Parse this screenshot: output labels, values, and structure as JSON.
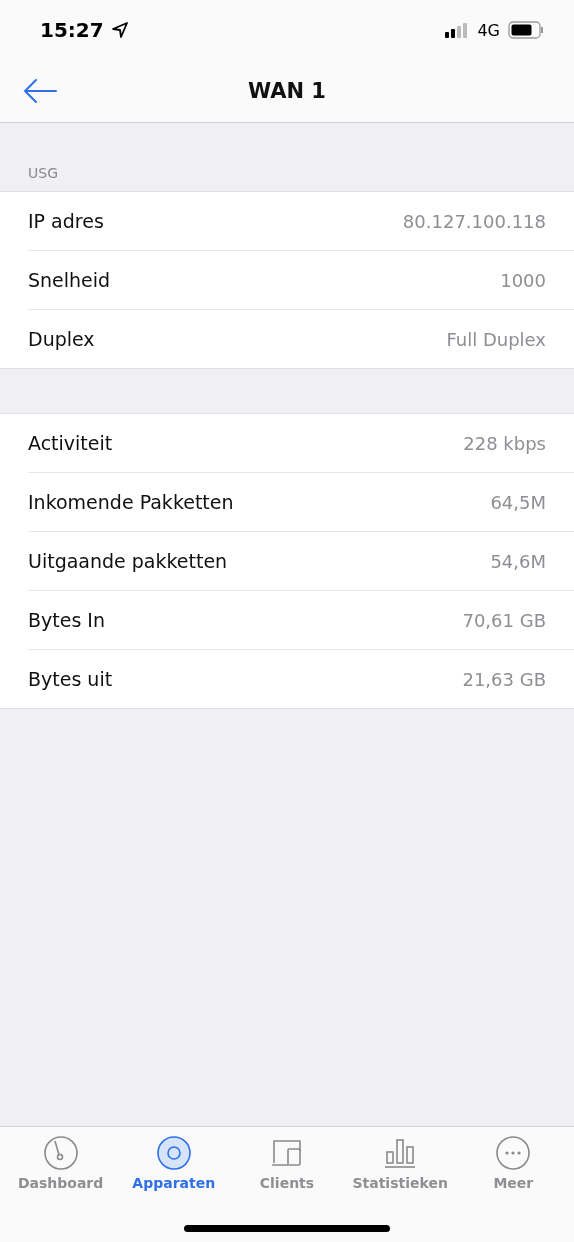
{
  "status_bar": {
    "time": "15:27",
    "network": "4G"
  },
  "nav": {
    "title": "WAN 1"
  },
  "sections": [
    {
      "header": "USG",
      "rows": [
        {
          "label": "IP adres",
          "value": "80.127.100.118"
        },
        {
          "label": "Snelheid",
          "value": "1000"
        },
        {
          "label": "Duplex",
          "value": "Full Duplex"
        }
      ]
    },
    {
      "rows": [
        {
          "label": "Activiteit",
          "value": "228 kbps"
        },
        {
          "label": "Inkomende Pakketten",
          "value": "64,5M"
        },
        {
          "label": "Uitgaande pakketten",
          "value": "54,6M"
        },
        {
          "label": "Bytes In",
          "value": "70,61 GB"
        },
        {
          "label": "Bytes uit",
          "value": "21,63 GB"
        }
      ]
    }
  ],
  "tabs": [
    {
      "kind": "dashboard",
      "label": "Dashboard",
      "selected": false
    },
    {
      "kind": "devices",
      "label": "Apparaten",
      "selected": true
    },
    {
      "kind": "clients",
      "label": "Clients",
      "selected": false
    },
    {
      "kind": "stats",
      "label": "Statistieken",
      "selected": false
    },
    {
      "kind": "more",
      "label": "Meer",
      "selected": false
    }
  ]
}
